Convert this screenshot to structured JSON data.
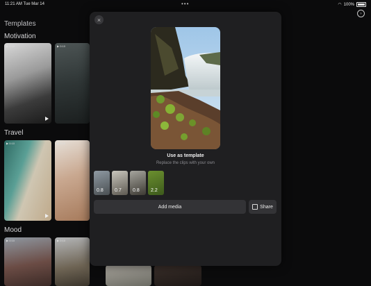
{
  "status_bar": {
    "time_date": "11:21 AM  Tue Mar 14",
    "battery": "100%"
  },
  "background": {
    "title": "Templates",
    "sections": [
      {
        "label": "Motivation"
      },
      {
        "label": "Travel"
      },
      {
        "label": "Mood"
      }
    ],
    "thumb_meta": "▶ 0:10"
  },
  "modal": {
    "close_icon": "×",
    "title": "Use as template",
    "subtitle": "Replace the clips with your own",
    "clips": [
      {
        "duration": "0.8"
      },
      {
        "duration": "0.7"
      },
      {
        "duration": "0.8"
      },
      {
        "duration": "2.2"
      }
    ],
    "add_media_label": "Add media",
    "share_label": "Share"
  }
}
